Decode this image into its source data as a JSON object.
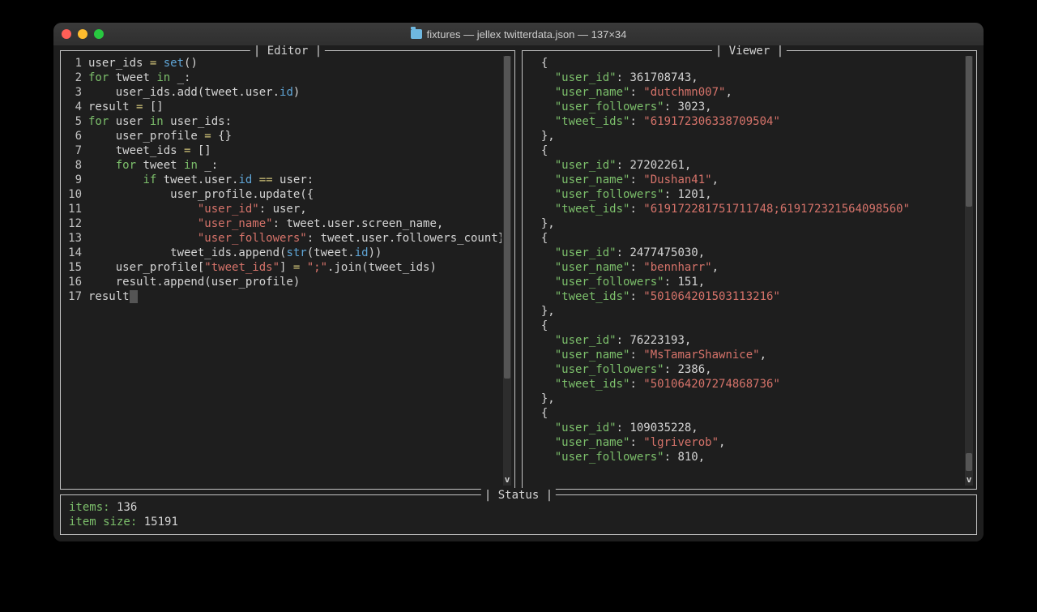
{
  "window": {
    "title": "fixtures — jellex twitterdata.json — 137×34"
  },
  "panes": {
    "editor_title": "Editor",
    "viewer_title": "Viewer",
    "status_title": "Status"
  },
  "editor": {
    "lines": [
      {
        "n": 1,
        "tokens": [
          [
            "",
            "user_ids "
          ],
          [
            "kw-yellow",
            "="
          ],
          [
            "",
            " "
          ],
          [
            "kw-blue",
            "set"
          ],
          [
            "",
            "()"
          ]
        ]
      },
      {
        "n": 2,
        "tokens": [
          [
            "kw-green",
            "for"
          ],
          [
            "",
            " tweet "
          ],
          [
            "kw-green",
            "in"
          ],
          [
            "",
            " _:"
          ]
        ]
      },
      {
        "n": 3,
        "tokens": [
          [
            "",
            "    user_ids.add(tweet.user."
          ],
          [
            "kw-blue",
            "id"
          ],
          [
            "",
            ")"
          ]
        ]
      },
      {
        "n": 4,
        "tokens": [
          [
            "",
            "result "
          ],
          [
            "kw-yellow",
            "="
          ],
          [
            "",
            " []"
          ]
        ]
      },
      {
        "n": 5,
        "tokens": [
          [
            "kw-green",
            "for"
          ],
          [
            "",
            " user "
          ],
          [
            "kw-green",
            "in"
          ],
          [
            "",
            " user_ids:"
          ]
        ]
      },
      {
        "n": 6,
        "tokens": [
          [
            "",
            "    user_profile "
          ],
          [
            "kw-yellow",
            "="
          ],
          [
            "",
            " {}"
          ]
        ]
      },
      {
        "n": 7,
        "tokens": [
          [
            "",
            "    tweet_ids "
          ],
          [
            "kw-yellow",
            "="
          ],
          [
            "",
            " []"
          ]
        ]
      },
      {
        "n": 8,
        "tokens": [
          [
            "",
            "    "
          ],
          [
            "kw-green",
            "for"
          ],
          [
            "",
            " tweet "
          ],
          [
            "kw-green",
            "in"
          ],
          [
            "",
            " _:"
          ]
        ]
      },
      {
        "n": 9,
        "tokens": [
          [
            "",
            "        "
          ],
          [
            "kw-green",
            "if"
          ],
          [
            "",
            " tweet.user."
          ],
          [
            "kw-blue",
            "id"
          ],
          [
            "",
            " "
          ],
          [
            "kw-yellow",
            "=="
          ],
          [
            "",
            " user:"
          ]
        ]
      },
      {
        "n": 10,
        "tokens": [
          [
            "",
            "            user_profile.update({"
          ]
        ]
      },
      {
        "n": 11,
        "tokens": [
          [
            "",
            "                "
          ],
          [
            "kw-red",
            "\"user_id\""
          ],
          [
            "",
            ": user,"
          ]
        ]
      },
      {
        "n": 12,
        "tokens": [
          [
            "",
            "                "
          ],
          [
            "kw-red",
            "\"user_name\""
          ],
          [
            "",
            ": tweet.user.screen_name,"
          ]
        ]
      },
      {
        "n": 13,
        "tokens": [
          [
            "",
            "                "
          ],
          [
            "kw-red",
            "\"user_followers\""
          ],
          [
            "",
            ": tweet.user.followers_count})"
          ]
        ]
      },
      {
        "n": 14,
        "tokens": [
          [
            "",
            "            tweet_ids.append("
          ],
          [
            "kw-blue",
            "str"
          ],
          [
            "",
            "(tweet."
          ],
          [
            "kw-blue",
            "id"
          ],
          [
            "",
            "))"
          ]
        ]
      },
      {
        "n": 15,
        "tokens": [
          [
            "",
            "    user_profile["
          ],
          [
            "kw-red",
            "\"tweet_ids\""
          ],
          [
            "",
            "] "
          ],
          [
            "kw-yellow",
            "="
          ],
          [
            "",
            " "
          ],
          [
            "kw-red",
            "\";\""
          ],
          [
            "",
            ".join(tweet_ids)"
          ]
        ]
      },
      {
        "n": 16,
        "tokens": [
          [
            "",
            "    result.append(user_profile)"
          ]
        ]
      },
      {
        "n": 17,
        "tokens": [
          [
            "",
            "result"
          ],
          [
            "cursor",
            " "
          ]
        ]
      }
    ]
  },
  "viewer": {
    "records": [
      {
        "user_id": 361708743,
        "user_name": "dutchmn007",
        "user_followers": 3023,
        "tweet_ids": "619172306338709504"
      },
      {
        "user_id": 27202261,
        "user_name": "Dushan41",
        "user_followers": 1201,
        "tweet_ids": "619172281751711748;619172321564098560"
      },
      {
        "user_id": 2477475030,
        "user_name": "bennharr",
        "user_followers": 151,
        "tweet_ids": "501064201503113216"
      },
      {
        "user_id": 76223193,
        "user_name": "MsTamarShawnice",
        "user_followers": 2386,
        "tweet_ids": "501064207274868736"
      },
      {
        "user_id": 109035228,
        "user_name": "lgriverob",
        "user_followers": 810,
        "tweet_ids": null
      }
    ]
  },
  "status": {
    "items_label": "items:",
    "items_value": "136",
    "size_label": "item size:",
    "size_value": "15191"
  },
  "scroll": {
    "up": "ʌ",
    "down": "v"
  }
}
